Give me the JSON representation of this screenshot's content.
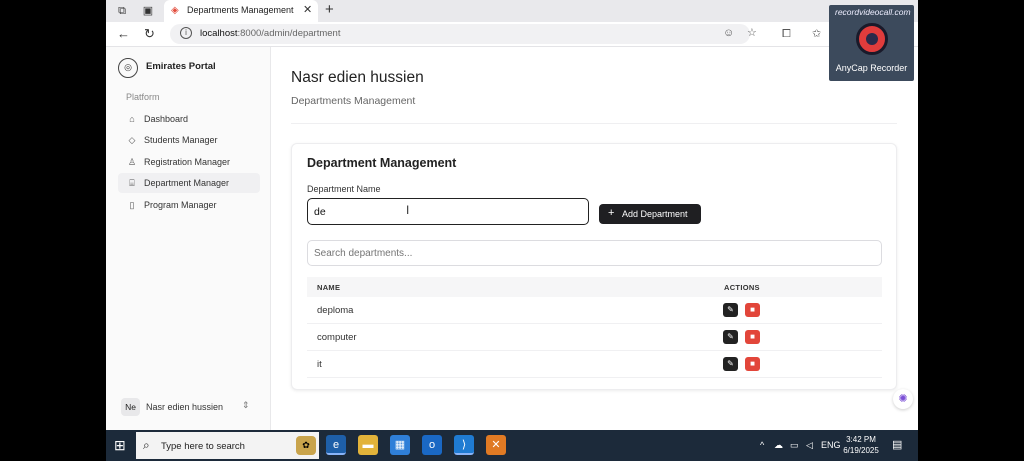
{
  "browser": {
    "tab_title": "Departments Management",
    "url_host": "localhost",
    "url_path": ":8000/admin/department"
  },
  "sidebar": {
    "brand": "Emirates Portal",
    "section_label": "Platform",
    "items": [
      {
        "label": "Dashboard",
        "icon": "home-icon",
        "active": false
      },
      {
        "label": "Students Manager",
        "icon": "graduation-cap-icon",
        "active": false
      },
      {
        "label": "Registration Manager",
        "icon": "user-icon",
        "active": false
      },
      {
        "label": "Department Manager",
        "icon": "building-icon",
        "active": true
      },
      {
        "label": "Program Manager",
        "icon": "book-icon",
        "active": false
      }
    ],
    "user": {
      "initials": "Ne",
      "name": "Nasr edien hussien"
    }
  },
  "header": {
    "title": "Nasr edien hussien",
    "subtitle": "Departments Management"
  },
  "card": {
    "title": "Department Management",
    "field_label": "Department Name",
    "field_value": "de",
    "add_button": "Add Department",
    "search_placeholder": "Search departments...",
    "columns": [
      "NAME",
      "ACTIONS"
    ],
    "rows": [
      {
        "name": "deploma"
      },
      {
        "name": "computer"
      },
      {
        "name": "it"
      }
    ]
  },
  "watermark": {
    "arc_text": "recordvideocall.com",
    "label": "AnyCap Recorder"
  },
  "taskbar": {
    "search_text": "Type here to search",
    "language": "ENG",
    "time": "3:42 PM",
    "date": "6/19/2025"
  },
  "colors": {
    "primary_button": "#1f1f22",
    "delete_button": "#e2463a",
    "taskbar": "#1c2a3a"
  }
}
